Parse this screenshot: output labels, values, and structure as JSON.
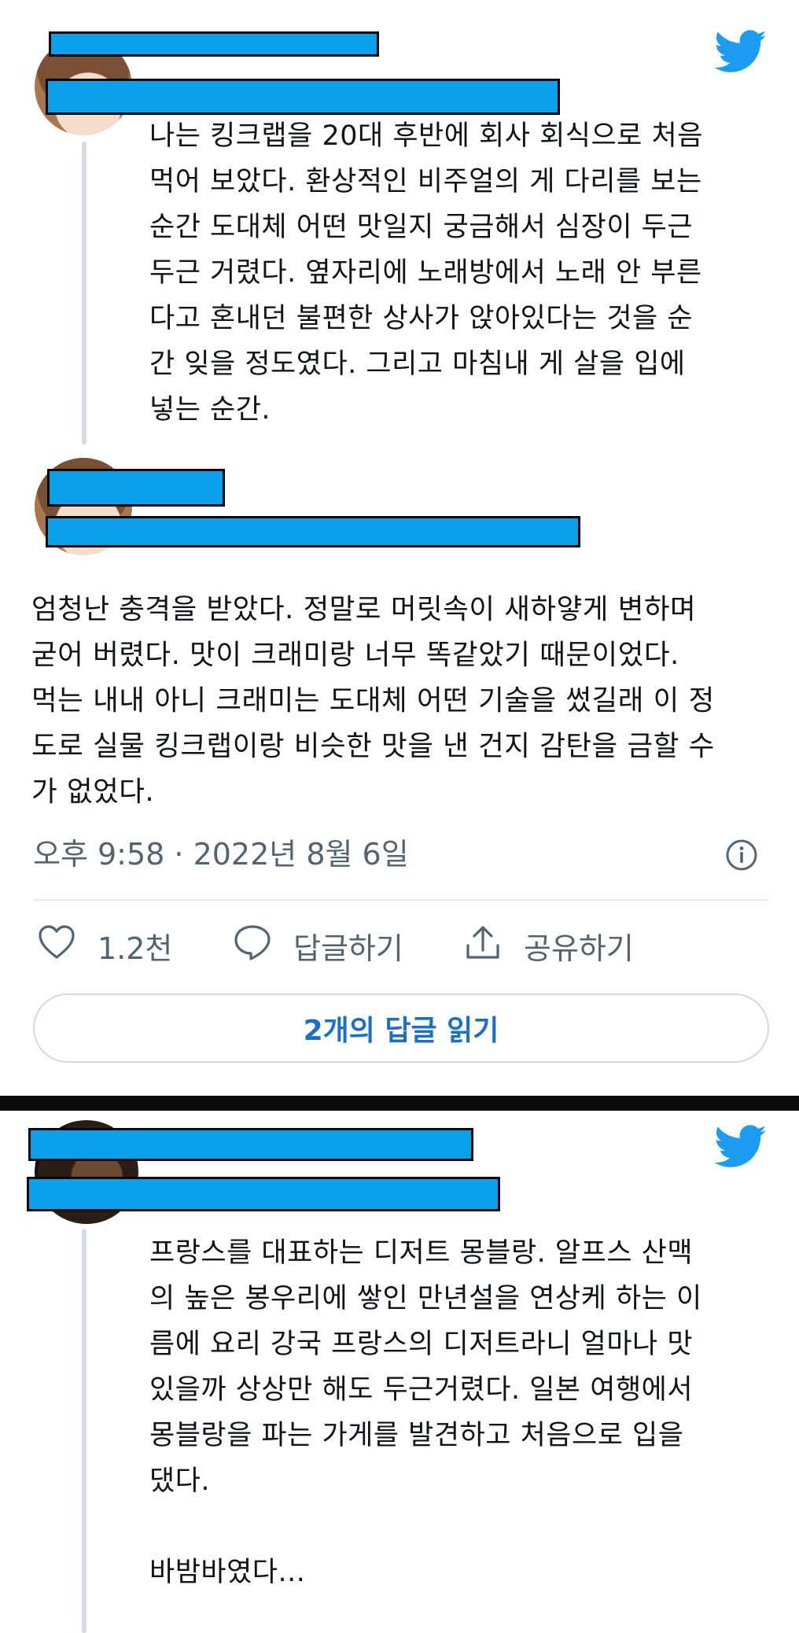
{
  "tweet1": {
    "text": "나는 킹크랩을 20대 후반에 회사 회식으로 처음\n먹어 보았다. 환상적인 비주얼의 게 다리를 보는\n순간 도대체 어떤 맛일지 궁금해서 심장이 두근\n두근 거렸다. 옆자리에 노래방에서 노래 안 부른\n다고 혼내던 불편한 상사가 앉아있다는 것을 순\n간 잊을 정도였다. 그리고 마침내 게 살을 입에\n넣는 순간."
  },
  "tweet2": {
    "text": "엄청난 충격을 받았다. 정말로 머릿속이 새하얗게 변하며\n굳어 버렸다. 맛이 크래미랑 너무 똑같았기 때문이었다.\n먹는 내내 아니 크래미는 도대체 어떤 기술을 썼길래 이 정\n도로 실물 킹크랩이랑 비슷한 맛을 낸 건지 감탄을 금할 수\n가 없었다.",
    "timestamp": "오후 9:58 · 2022년 8월 6일",
    "like_count": "1.2천",
    "reply_label": "답글하기",
    "share_label": "공유하기",
    "read_replies_label": "2개의 답글 읽기"
  },
  "tweet3": {
    "text": "프랑스를 대표하는 디저트 몽블랑. 알프스 산맥\n의 높은 봉우리에 쌓인 만년설을 연상케 하는 이\n름에 요리 강국 프랑스의 디저트라니 얼마나 맛\n있을까 상상만 해도 두근거렸다. 일본 여행에서\n몽블랑을 파는 가게를 발견하고 처음으로 입을\n댔다.\n\n바밤바였다..."
  },
  "colors": {
    "twitter_blue": "#1d9bf0",
    "redaction": "#0aa0ea",
    "link_blue": "#1d6fc4",
    "muted_text": "#536471"
  },
  "icons": [
    "twitter-bird-icon",
    "info-icon",
    "heart-icon",
    "reply-bubble-icon",
    "share-icon"
  ]
}
